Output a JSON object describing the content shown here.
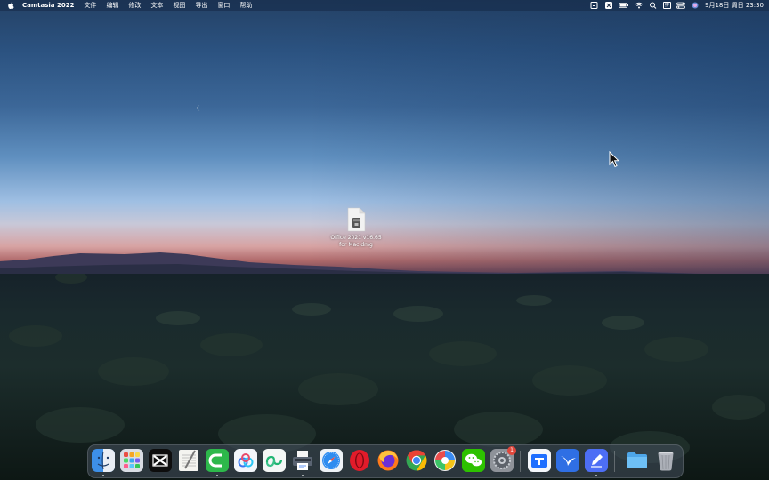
{
  "menubar": {
    "app_name": "Camtasia 2022",
    "menus": [
      "文件",
      "编辑",
      "修改",
      "文本",
      "视图",
      "导出",
      "窗口",
      "帮助"
    ],
    "status_icons": [
      "screen-mirroring-icon",
      "capcut-tray-icon",
      "battery-icon",
      "wifi-icon",
      "search-icon",
      "input-method-icon",
      "control-center-icon",
      "siri-icon"
    ],
    "input_method": "拼",
    "clock": "9月18日 周日 23:30"
  },
  "desktop": {
    "file": {
      "name_line1": "Office 2021 v16.65",
      "name_line2": "for Mac.dmg",
      "icon": "disk-image-icon"
    }
  },
  "dock": {
    "apps": [
      {
        "name": "Finder",
        "icon": "finder-icon",
        "running": true
      },
      {
        "name": "Launchpad",
        "icon": "launchpad-icon",
        "running": false
      },
      {
        "name": "CapCut",
        "icon": "capcut-icon",
        "running": false
      },
      {
        "name": "TextEdit",
        "icon": "textedit-icon",
        "running": false
      },
      {
        "name": "Camtasia 2022",
        "icon": "camtasia-icon",
        "running": true
      },
      {
        "name": "Baidu Netdisk",
        "icon": "baidu-netdisk-icon",
        "running": false
      },
      {
        "name": "Aliyun Drive",
        "icon": "aliyun-drive-icon",
        "running": false
      },
      {
        "name": "Printer",
        "icon": "printer-icon",
        "running": true
      },
      {
        "name": "Safari",
        "icon": "safari-icon",
        "running": false
      },
      {
        "name": "Opera",
        "icon": "opera-icon",
        "running": false
      },
      {
        "name": "Firefox",
        "icon": "firefox-icon",
        "running": false
      },
      {
        "name": "Chrome",
        "icon": "chrome-icon",
        "running": false
      },
      {
        "name": "Pinwheel",
        "icon": "pinwheel-icon",
        "running": false
      },
      {
        "name": "WeChat",
        "icon": "wechat-icon",
        "running": false
      },
      {
        "name": "System Preferences",
        "icon": "system-preferences-icon",
        "running": false,
        "badge": "1"
      },
      {
        "name": "Tencent Docs",
        "icon": "tencent-docs-icon",
        "running": false
      },
      {
        "name": "Feishu",
        "icon": "feishu-icon",
        "running": false
      },
      {
        "name": "Notes Editor",
        "icon": "pen-editor-icon",
        "running": true
      },
      {
        "name": "Downloads",
        "icon": "folder-icon",
        "running": false
      },
      {
        "name": "Trash",
        "icon": "trash-icon",
        "running": false
      }
    ]
  }
}
